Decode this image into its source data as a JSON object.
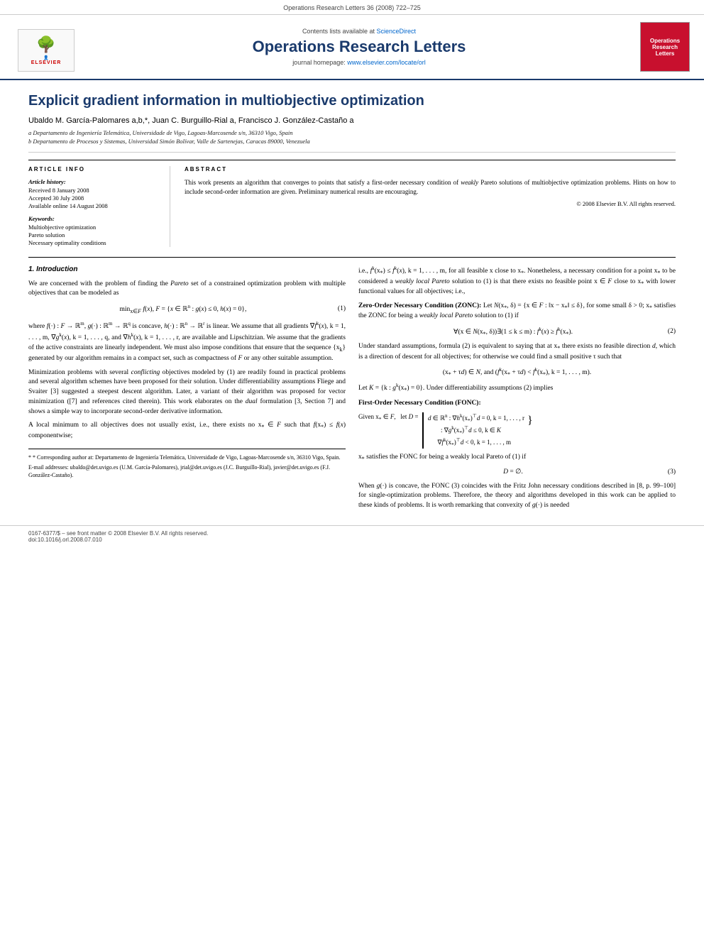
{
  "topBar": {
    "text": "Operations Research Letters 36 (2008) 722–725"
  },
  "journalHeader": {
    "contentsLine": "Contents lists available at",
    "scienceDirectLabel": "ScienceDirect",
    "journalTitle": "Operations Research Letters",
    "homepageLine": "journal homepage:",
    "homepageUrl": "www.elsevier.com/locate/orl",
    "logoRight": {
      "line1": "Operations",
      "line2": "Research",
      "line3": "Letters"
    },
    "elsevier": "ELSEVIER"
  },
  "article": {
    "title": "Explicit gradient information in multiobjective optimization",
    "authors": "Ubaldo M. García-Palomares a,b,*, Juan C. Burguillo-Rial a, Francisco J. González-Castaño a",
    "affiliationA": "a Departamento de Ingeniería Telemática, Universidade de Vigo, Lagoas-Marcosende s/n, 36310 Vigo, Spain",
    "affiliationB": "b Departamento de Procesos y Sistemas, Universidad Simón Bolívar, Valle de Sartenejas, Caracas 89000, Venezuela"
  },
  "articleInfo": {
    "sectionLabel": "ARTICLE INFO",
    "historyLabel": "Article history:",
    "received": "Received 8 January 2008",
    "accepted": "Accepted 30 July 2008",
    "availableOnline": "Available online 14 August 2008",
    "keywordsLabel": "Keywords:",
    "keywords": [
      "Multiobjective optimization",
      "Pareto solution",
      "Necessary optimality conditions"
    ]
  },
  "abstract": {
    "sectionLabel": "ABSTRACT",
    "text": "This work presents an algorithm that converges to points that satisfy a first-order necessary condition of weakly Pareto solutions of multiobjective optimization problems. Hints on how to include second-order information are given. Preliminary numerical results are encouraging.",
    "copyright": "© 2008 Elsevier B.V. All rights reserved."
  },
  "intro": {
    "sectionNumber": "1.",
    "sectionTitle": "Introduction",
    "paragraph1": "We are concerned with the problem of finding the Pareto set of a constrained optimization problem with multiple objectives that can be modeled as",
    "eq1": "min f(x), F = {x ∈ Rⁿ : g(x) ≤ 0, h(x) = 0},",
    "eq1Number": "(1)",
    "paragraph2": "where f(·) : F → Rᵐ, g(·) : Rᵐ → Rᵠ is concave, h(·) : Rⁿ → Rʳ is linear. We assume that all gradients ∇fᵏ(x), k = 1, . . . , m, ∇gᵏ(x), k = 1, . . . , q, and ∇hᵏ(x), k = 1, . . . , r, are available and Lipschitzian. We assume that the gradients of the active constraints are linearly independent. We must also impose conditions that ensure that the sequence {xₖ} generated by our algorithm remains in a compact set, such as compactness of F or any other suitable assumption.",
    "paragraph3": "Minimization problems with several conflicting objectives modeled by (1) are readily found in practical problems and several algorithm schemes have been proposed for their solution. Under differentiability assumptions Fliege and Svaiter [3] suggested a steepest descent algorithm. Later, a variant of their algorithm was proposed for vector minimization ([7] and references cited therein). This work elaborates on the dual formulation [3, Section 7] and shows a simple way to incorporate second-order derivative information.",
    "paragraph4": "A local minimum to all objectives does not usually exist, i.e., there exists no x* ∈ F such that f(x*) ≤ f(x) componentwise;"
  },
  "rightCol": {
    "paragraph1": "i.e., fᵏ(x*) ≤ fᵏ(x), k = 1, . . . , m, for all feasible x close to x*. Nonetheless, a necessary condition for a point x* to be considered a weakly local Pareto solution to (1) is that there exists no feasible point x ∈ F close to x* with lower functional values for all objectives; i.e.,",
    "zoncTitle": "Zero-Order Necessary Condition (ZONC):",
    "zoncText": "Let N(x*, δ) = {x ∈ F : ‖x − x*‖ ≤ δ}, for some small δ > 0; x* satisfies the ZONC for being a weakly local Pareto solution to (1) if",
    "eq2": "∀(x ∈ N(x*, δ))∃(1 ≤ k ≤ m) : fᵏ(x) ≥ fᵏ(x*).",
    "eq2Number": "(2)",
    "paragraph2": "Under standard assumptions, formula (2) is equivalent to saying that at x* there exists no feasible direction d, which is a direction of descent for all objectives; for otherwise we could find a small positive τ such that",
    "eq3text": "(x* + τd) ∈ N,   and   (fᵏ(x* + τd) < fᵏ(x*), k = 1, . . . , m).",
    "paragraph3": "Let K = {k : gᵏ(x*) = 0}. Under differentiability assumptions (2) implies",
    "foncTitle": "First-Order Necessary Condition (FONC):",
    "givenLabel": "Given x* ∈ F,    let D =",
    "braceLines": [
      "d ∈ Rⁿ : ∇hᵏ(x*)ᵀd = 0, k = 1, . . . , r",
      ": ∇gᵏ(x*)ᵀd ≤ 0, k ∈ K",
      "∇fᵏ(x*)ᵀd < 0, k = 1, . . . , m"
    ],
    "foncConclusion": "x* satisfies the FONC for being a weakly local Pareto of (1) if",
    "eq3": "D = ∅.",
    "eq3Number": "(3)",
    "paragraph4": "When g(·) is concave, the FONC (3) coincides with the Fritz John necessary conditions described in [8, p. 99–100] for single-optimization problems. Therefore, the theory and algorithms developed in this work can be applied to these kinds of problems. It is worth remarking that convexity of g(·) is needed"
  },
  "footnote": {
    "star": "* Corresponding author at: Departamento de Ingeniería Telemática, Universidade de Vigo, Lagoas-Marcosende s/n, 36310 Vigo, Spain.",
    "email": "E-mail addresses: ubaldo@det.uvigo.es (U.M. García-Palomares), jrial@det.uvigo.es (J.C. Burguillo-Rial), javier@det.uvigo.es (F.J. González-Castaño)."
  },
  "footer": {
    "line1": "0167-6377/$ – see front matter © 2008 Elsevier B.V. All rights reserved.",
    "line2": "doi:10.1016/j.orl.2008.07.010"
  }
}
